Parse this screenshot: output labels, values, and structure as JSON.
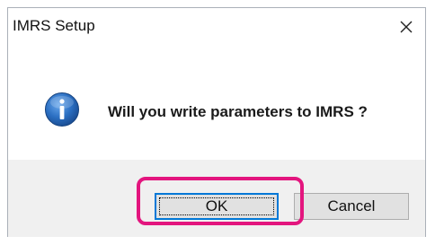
{
  "dialog": {
    "title": "IMRS Setup",
    "message": "Will you write parameters to IMRS ?",
    "icon": "info-icon",
    "buttons": {
      "ok_label": "OK",
      "cancel_label": "Cancel"
    }
  },
  "colors": {
    "highlight": "#e3157e",
    "focus_border": "#0078d7",
    "icon_blue": "#2b6fc2",
    "footer_bg": "#f0f0f0"
  }
}
